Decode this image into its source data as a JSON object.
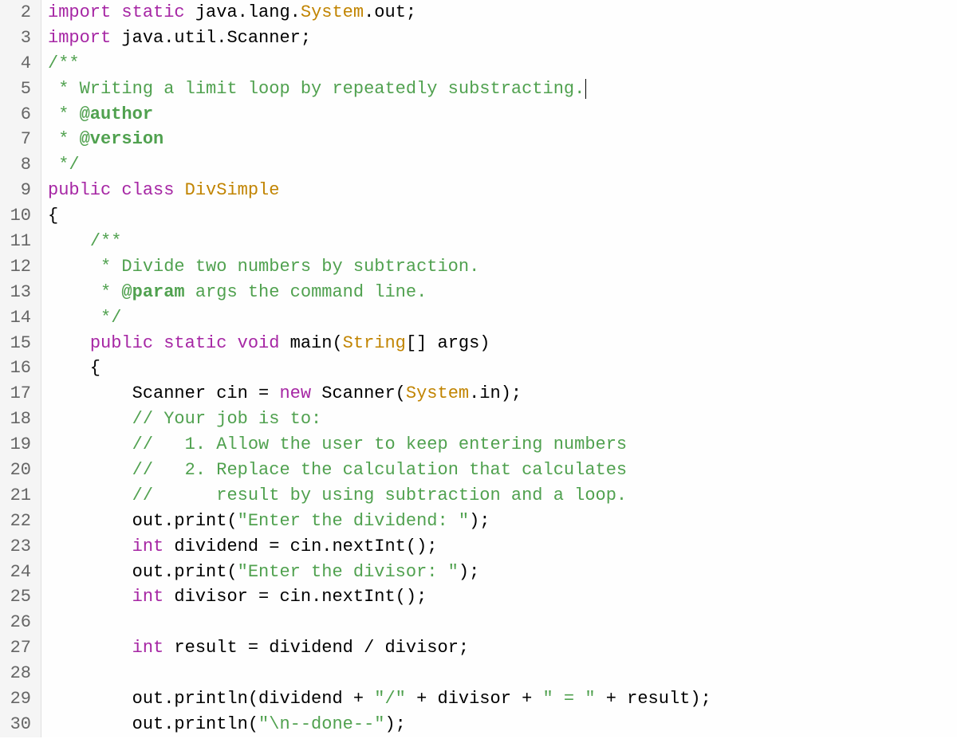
{
  "lines": [
    {
      "num": 2,
      "tokens": [
        {
          "t": "kw",
          "v": "import static"
        },
        {
          "t": "p",
          "v": " java.lang."
        },
        {
          "t": "type",
          "v": "System"
        },
        {
          "t": "p",
          "v": ".out;"
        }
      ]
    },
    {
      "num": 3,
      "tokens": [
        {
          "t": "kw",
          "v": "import"
        },
        {
          "t": "p",
          "v": " java.util.Scanner;"
        }
      ]
    },
    {
      "num": 4,
      "tokens": [
        {
          "t": "comment",
          "v": "/**"
        }
      ]
    },
    {
      "num": 5,
      "tokens": [
        {
          "t": "comment",
          "v": " * Writing a limit loop by repeatedly substracting."
        },
        {
          "t": "cursor",
          "v": ""
        }
      ]
    },
    {
      "num": 6,
      "tokens": [
        {
          "t": "comment",
          "v": " * "
        },
        {
          "t": "doctag",
          "v": "@author"
        }
      ]
    },
    {
      "num": 7,
      "tokens": [
        {
          "t": "comment",
          "v": " * "
        },
        {
          "t": "doctag",
          "v": "@version"
        }
      ]
    },
    {
      "num": 8,
      "tokens": [
        {
          "t": "comment",
          "v": " */"
        }
      ]
    },
    {
      "num": 9,
      "tokens": [
        {
          "t": "kw",
          "v": "public class"
        },
        {
          "t": "p",
          "v": " "
        },
        {
          "t": "type",
          "v": "DivSimple"
        }
      ]
    },
    {
      "num": 10,
      "tokens": [
        {
          "t": "p",
          "v": "{"
        }
      ]
    },
    {
      "num": 11,
      "tokens": [
        {
          "t": "p",
          "v": "    "
        },
        {
          "t": "comment",
          "v": "/**"
        }
      ]
    },
    {
      "num": 12,
      "tokens": [
        {
          "t": "p",
          "v": "    "
        },
        {
          "t": "comment",
          "v": " * Divide two numbers by subtraction."
        }
      ]
    },
    {
      "num": 13,
      "tokens": [
        {
          "t": "p",
          "v": "    "
        },
        {
          "t": "comment",
          "v": " * "
        },
        {
          "t": "doctag",
          "v": "@param"
        },
        {
          "t": "comment",
          "v": " args the command line."
        }
      ]
    },
    {
      "num": 14,
      "tokens": [
        {
          "t": "p",
          "v": "    "
        },
        {
          "t": "comment",
          "v": " */"
        }
      ]
    },
    {
      "num": 15,
      "tokens": [
        {
          "t": "p",
          "v": "    "
        },
        {
          "t": "kw",
          "v": "public static void"
        },
        {
          "t": "p",
          "v": " main("
        },
        {
          "t": "type",
          "v": "String"
        },
        {
          "t": "p",
          "v": "[] args)"
        }
      ]
    },
    {
      "num": 16,
      "tokens": [
        {
          "t": "p",
          "v": "    {"
        }
      ]
    },
    {
      "num": 17,
      "tokens": [
        {
          "t": "p",
          "v": "        Scanner cin = "
        },
        {
          "t": "kw",
          "v": "new"
        },
        {
          "t": "p",
          "v": " Scanner("
        },
        {
          "t": "type",
          "v": "System"
        },
        {
          "t": "p",
          "v": ".in);"
        }
      ]
    },
    {
      "num": 18,
      "tokens": [
        {
          "t": "p",
          "v": "        "
        },
        {
          "t": "comment",
          "v": "// Your job is to:"
        }
      ]
    },
    {
      "num": 19,
      "tokens": [
        {
          "t": "p",
          "v": "        "
        },
        {
          "t": "comment",
          "v": "//   1. Allow the user to keep entering numbers"
        }
      ]
    },
    {
      "num": 20,
      "tokens": [
        {
          "t": "p",
          "v": "        "
        },
        {
          "t": "comment",
          "v": "//   2. Replace the calculation that calculates"
        }
      ]
    },
    {
      "num": 21,
      "tokens": [
        {
          "t": "p",
          "v": "        "
        },
        {
          "t": "comment",
          "v": "//      result by using subtraction and a loop."
        }
      ]
    },
    {
      "num": 22,
      "tokens": [
        {
          "t": "p",
          "v": "        out.print("
        },
        {
          "t": "str",
          "v": "\"Enter the dividend: \""
        },
        {
          "t": "p",
          "v": ");"
        }
      ]
    },
    {
      "num": 23,
      "tokens": [
        {
          "t": "p",
          "v": "        "
        },
        {
          "t": "kw",
          "v": "int"
        },
        {
          "t": "p",
          "v": " dividend = cin.nextInt();"
        }
      ]
    },
    {
      "num": 24,
      "tokens": [
        {
          "t": "p",
          "v": "        out.print("
        },
        {
          "t": "str",
          "v": "\"Enter the divisor: \""
        },
        {
          "t": "p",
          "v": ");"
        }
      ]
    },
    {
      "num": 25,
      "tokens": [
        {
          "t": "p",
          "v": "        "
        },
        {
          "t": "kw",
          "v": "int"
        },
        {
          "t": "p",
          "v": " divisor = cin.nextInt();"
        }
      ]
    },
    {
      "num": 26,
      "tokens": [
        {
          "t": "p",
          "v": ""
        }
      ]
    },
    {
      "num": 27,
      "tokens": [
        {
          "t": "p",
          "v": "        "
        },
        {
          "t": "kw",
          "v": "int"
        },
        {
          "t": "p",
          "v": " result = dividend / divisor;"
        }
      ]
    },
    {
      "num": 28,
      "tokens": [
        {
          "t": "p",
          "v": ""
        }
      ]
    },
    {
      "num": 29,
      "tokens": [
        {
          "t": "p",
          "v": "        out.println(dividend + "
        },
        {
          "t": "str",
          "v": "\"/\""
        },
        {
          "t": "p",
          "v": " + divisor + "
        },
        {
          "t": "str",
          "v": "\" = \""
        },
        {
          "t": "p",
          "v": " + result);"
        }
      ]
    },
    {
      "num": 30,
      "tokens": [
        {
          "t": "p",
          "v": "        out.println("
        },
        {
          "t": "str",
          "v": "\"\\n--done--\""
        },
        {
          "t": "p",
          "v": ");"
        }
      ]
    }
  ]
}
